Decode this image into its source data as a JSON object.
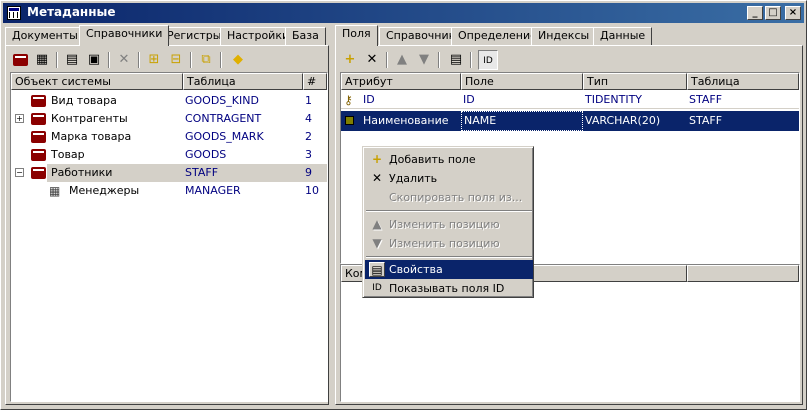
{
  "window": {
    "title": "Метаданные"
  },
  "left_tabs": [
    "Документы",
    "Справочники",
    "Регистры",
    "Настройки",
    "База"
  ],
  "right_tabs": [
    "Поля",
    "Справочник",
    "Определение",
    "Индексы",
    "Данные"
  ],
  "left_table": {
    "columns": [
      "Объект системы",
      "Таблица",
      "#"
    ],
    "rows": [
      {
        "name": "Вид товара",
        "table": "GOODS_KIND",
        "num": "1"
      },
      {
        "name": "Контрагенты",
        "table": "CONTRAGENT",
        "num": "4"
      },
      {
        "name": "Марка товара",
        "table": "GOODS_MARK",
        "num": "2"
      },
      {
        "name": "Товар",
        "table": "GOODS",
        "num": "3"
      },
      {
        "name": "Работники",
        "table": "STAFF",
        "num": "9"
      },
      {
        "name": "Менеджеры",
        "table": "MANAGER",
        "num": "10"
      }
    ]
  },
  "right_table": {
    "columns": [
      "Атрибут",
      "Поле",
      "Тип",
      "Таблица"
    ],
    "rows": [
      {
        "attr": "ID",
        "field": "ID",
        "type": "TIDENTITY",
        "table": "STAFF"
      },
      {
        "attr": "Наименование",
        "field": "NAME",
        "type": "VARCHAR(20)",
        "table": "STAFF"
      }
    ]
  },
  "bottom_header": "Ком",
  "toolbar_right": {
    "id_label": "ID"
  },
  "context_menu": [
    {
      "label": "Добавить поле",
      "icon": "plus-icon",
      "disabled": false
    },
    {
      "label": "Удалить",
      "icon": "delete-icon",
      "disabled": false
    },
    {
      "label": "Скопировать поля из...",
      "icon": "",
      "disabled": true
    },
    {
      "label": "Изменить позицию",
      "icon": "arrow-up-icon",
      "disabled": true
    },
    {
      "label": "Изменить позицию",
      "icon": "arrow-down-icon",
      "disabled": true
    },
    {
      "label": "Свойства",
      "icon": "properties-icon",
      "disabled": false
    },
    {
      "label": "Показывать поля ID",
      "icon": "id-icon",
      "disabled": false
    }
  ]
}
